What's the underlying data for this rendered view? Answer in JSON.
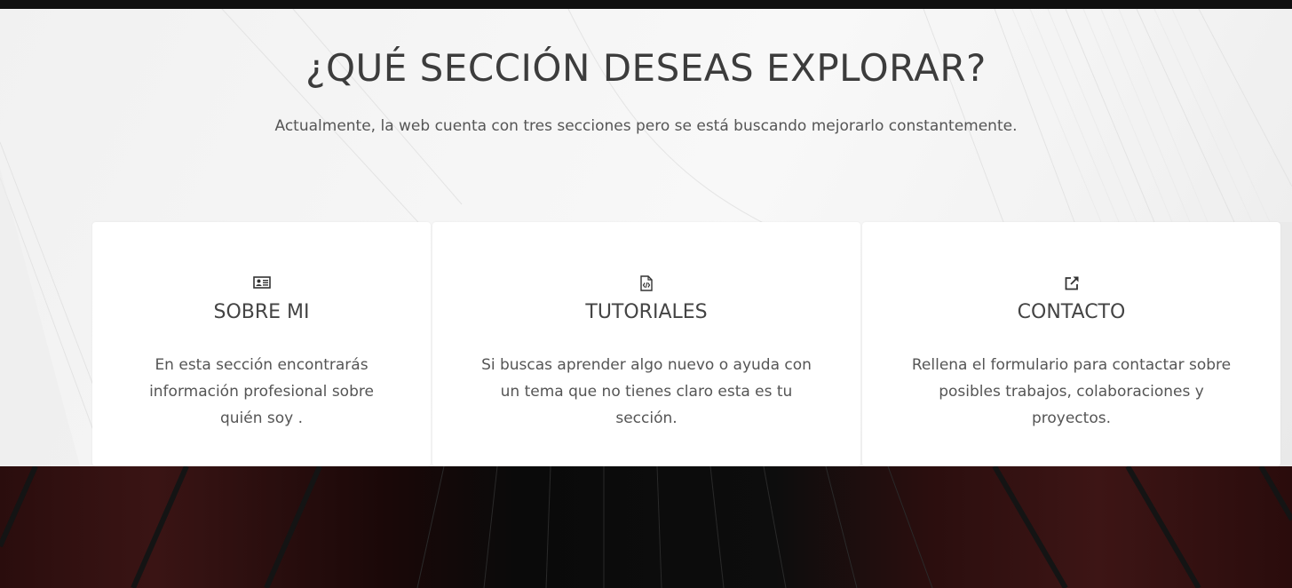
{
  "section": {
    "title": "¿QUÉ SECCIÓN DESEAS EXPLORAR?",
    "subtitle": "Actualmente, la web cuenta con tres secciones pero se está buscando mejorarlo constantemente."
  },
  "cards": [
    {
      "icon": "id-card-icon",
      "title": "SOBRE MI",
      "text": "En esta sección encontrarás información profesional sobre quién soy ."
    },
    {
      "icon": "file-code-icon",
      "title": "TUTORIALES",
      "text": "Si buscas aprender algo nuevo o ayuda con un tema que no tienes claro esta es tu sección."
    },
    {
      "icon": "external-link-icon",
      "title": "CONTACTO",
      "text": "Rellena el formulario para contactar sobre posibles trabajos, colaboraciones y proyectos."
    }
  ],
  "colors": {
    "light_background": "#f5f5f5",
    "dark_background": "#0d0d0d",
    "dark_accent": "#3a1414",
    "card_background": "#ffffff",
    "text": "#444444"
  }
}
